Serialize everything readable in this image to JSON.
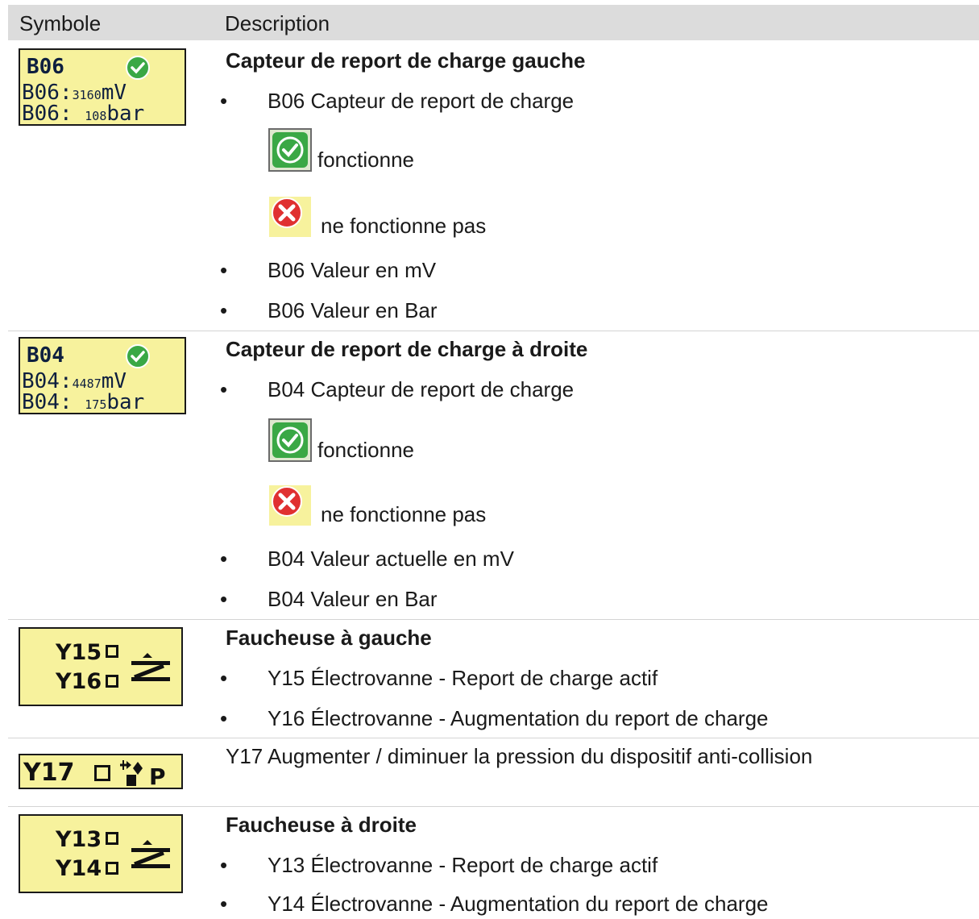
{
  "header": {
    "col_symbol": "Symbole",
    "col_description": "Description"
  },
  "rows": [
    {
      "display": {
        "l1": "B06",
        "l2_code": "B06:",
        "l2_value": "3160",
        "l2_unit": "mV",
        "l3_code": "B06:",
        "l3_value": "108",
        "l3_unit": "bar"
      },
      "title": "Capteur de report de charge gauche",
      "bullets": [
        "B06 Capteur de report de charge",
        "B06 Valeur en mV",
        "B06 Valeur en Bar"
      ],
      "status_ok": "fonctionne",
      "status_err": "ne fonctionne pas"
    },
    {
      "display": {
        "l1": "B04",
        "l2_code": "B04:",
        "l2_value": "4487",
        "l2_unit": "mV",
        "l3_code": "B04:",
        "l3_value": "175",
        "l3_unit": "bar"
      },
      "title": "Capteur de report de charge à droite",
      "bullets": [
        "B04 Capteur de report de charge",
        "B04 Valeur actuelle en mV",
        "B04 Valeur en Bar"
      ],
      "status_ok": "fonctionne",
      "status_err": "ne fonctionne pas"
    },
    {
      "display": {
        "v1": "Y15",
        "v2": "Y16"
      },
      "title": "Faucheuse à gauche",
      "bullets": [
        "Y15 Électrovanne - Report de charge actif",
        "Y16 Électrovanne - Augmentation du report de charge"
      ]
    },
    {
      "display": {
        "v": "Y17",
        "icon_letter": "P"
      },
      "text": "Y17 Augmenter / diminuer la pression du dispositif anti-collision"
    },
    {
      "display": {
        "v1": "Y13",
        "v2": "Y14"
      },
      "title": "Faucheuse à droite",
      "bullets": [
        "Y13 Électrovanne - Report de charge actif",
        "Y14 Électrovanne - Augmentation du report de charge"
      ]
    }
  ],
  "bullet_char": "•",
  "colors": {
    "header_bg": "#dcdcdc",
    "display_bg": "#f7f29d",
    "ok_green": "#3aa845",
    "err_red": "#e03030"
  },
  "icons": {
    "ok": "green-check-icon",
    "err": "red-x-icon",
    "valve_arrow": "load-transfer-arrow-icon",
    "pressure": "collision-pressure-icon"
  }
}
